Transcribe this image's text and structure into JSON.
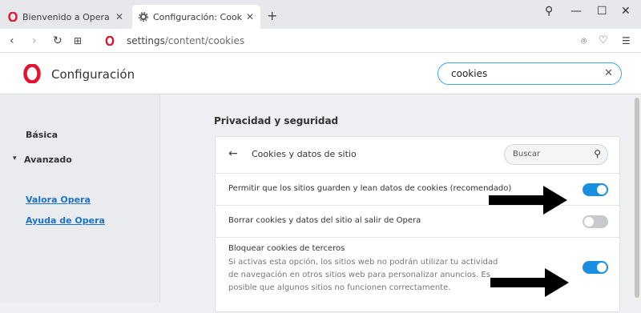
{
  "tabs": [
    {
      "title": "Bienvenido a Opera",
      "icon": "opera-icon",
      "active": false
    },
    {
      "title": "Configuración: Cookies y d",
      "icon": "gear-icon",
      "active": true
    }
  ],
  "address": {
    "host": "settings",
    "path": "/content/cookies"
  },
  "header": {
    "title": "Configuración",
    "search_value": "cookies"
  },
  "sidebar": {
    "items": [
      "Básica",
      "Avanzado"
    ],
    "links": [
      "Valora Opera",
      "Ayuda de Opera"
    ]
  },
  "section": {
    "title": "Privacidad y seguridad"
  },
  "card": {
    "title": "Cookies y datos de sitio",
    "search_placeholder": "Buscar",
    "rows": [
      {
        "label": "Permitir que los sitios guarden y lean datos de cookies (recomendado)",
        "enabled": true
      },
      {
        "label": "Borrar cookies y datos del sitio al salir de Opera",
        "enabled": false
      },
      {
        "label": "Bloquear cookies de terceros",
        "desc": "Si activas esta opción, los sitios web no podrán utilizar tu actividad de navegación en otros sitios web para personalizar anuncios. Es posible que algunos sitios no funcionen correctamente.",
        "enabled": true
      }
    ]
  },
  "colors": {
    "accent": "#1a8fe0",
    "opera_red": "#e5122d",
    "link": "#1a73c8"
  }
}
